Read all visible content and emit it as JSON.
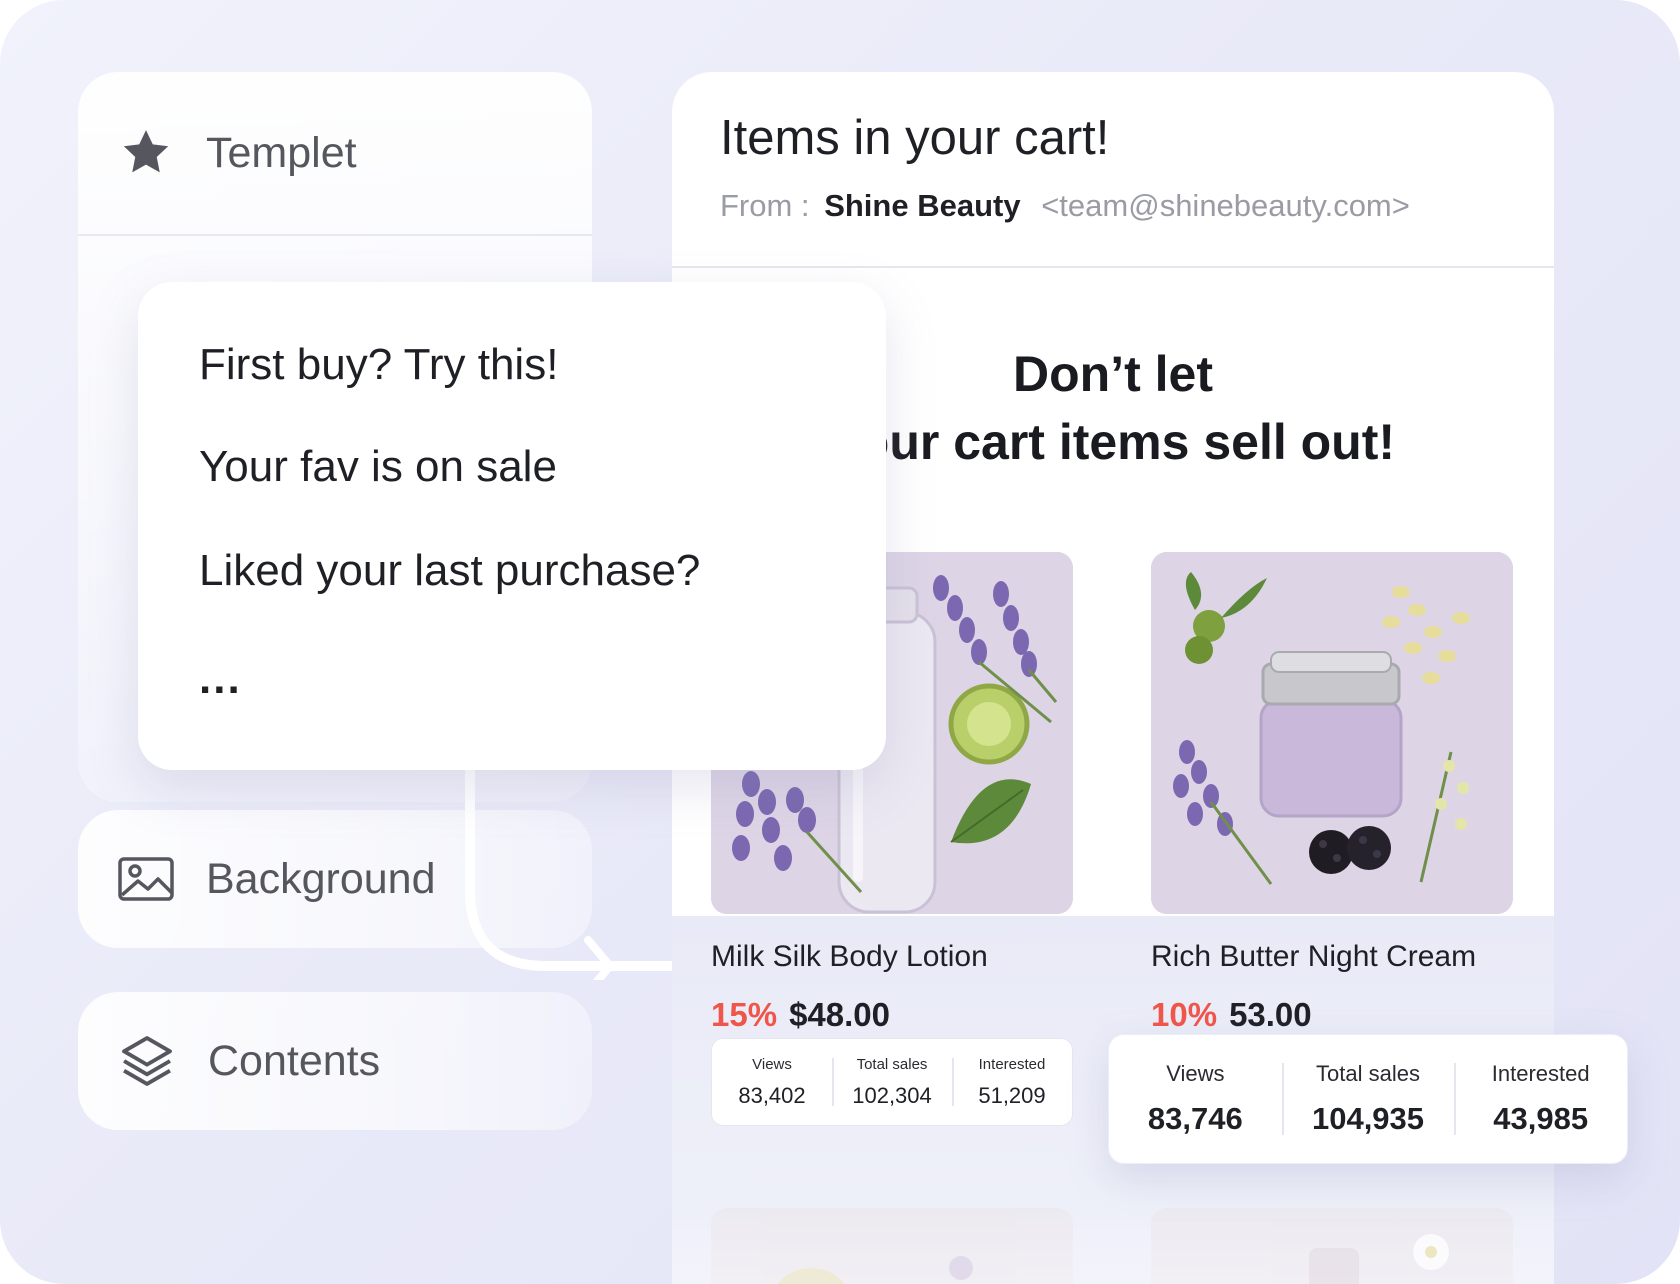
{
  "sidebar": {
    "templet_label": "Templet",
    "background_label": "Background",
    "contents_label": "Contents"
  },
  "template_popup": {
    "options": [
      "First buy? Try this!",
      "Your fav is on sale",
      "Liked your last purchase?"
    ],
    "more": "..."
  },
  "email": {
    "subject": "Items in your cart!",
    "from_label": "From :",
    "sender_name": "Shine Beauty",
    "sender_email": "<team@shinebeauty.com>",
    "headline_line1": "Don’t let",
    "headline_line2": "your cart items sell out!",
    "products": [
      {
        "name": "Milk Silk Body Lotion",
        "discount": "15%",
        "price": "$48.00",
        "stats": [
          {
            "label": "Views",
            "value": "83,402"
          },
          {
            "label": "Total sales",
            "value": "102,304"
          },
          {
            "label": "Interested",
            "value": "51,209"
          }
        ]
      },
      {
        "name": "Rich Butter Night Cream",
        "discount": "10%",
        "price": "53.00",
        "stats": [
          {
            "label": "Views",
            "value": "83,746"
          },
          {
            "label": "Total sales",
            "value": "104,935"
          },
          {
            "label": "Interested",
            "value": "43,985"
          }
        ]
      }
    ]
  },
  "colors": {
    "accent_discount": "#f0554a",
    "text_dark": "#1f2026",
    "text_muted": "#9a9ba4",
    "product_bg": "#ddd5e6",
    "lavender": "#7b68b0"
  }
}
